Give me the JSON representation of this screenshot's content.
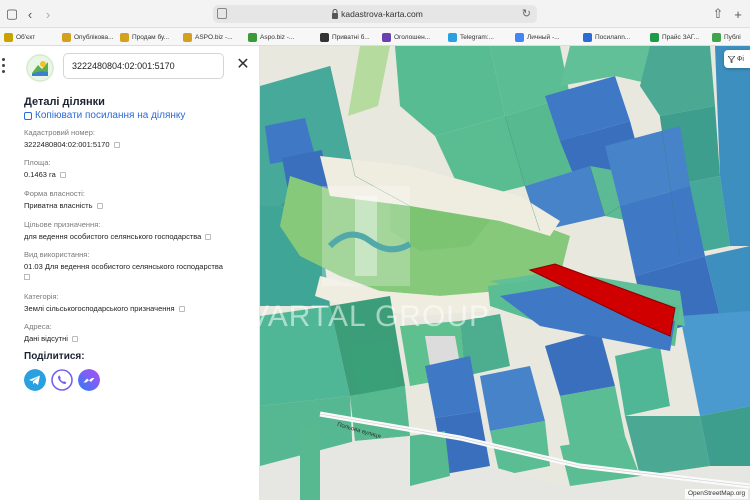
{
  "browser": {
    "url": "kadastrova-karta.com",
    "bookmarks": [
      {
        "label": "Об'єкт",
        "color": "#c8a200"
      },
      {
        "label": "Опублікова...",
        "color": "#d4a020"
      },
      {
        "label": "Продам бу...",
        "color": "#d4a020"
      },
      {
        "label": "ASPO.biz -...",
        "color": "#d4a020"
      },
      {
        "label": "Aspo.biz -...",
        "color": "#3a9a3a"
      },
      {
        "label": "Приватні б...",
        "color": "#333333"
      },
      {
        "label": "Оголошен...",
        "color": "#6b3fb0"
      },
      {
        "label": "Telegram:...",
        "color": "#2aa0e0"
      },
      {
        "label": "Личный -...",
        "color": "#4285f4"
      },
      {
        "label": "Посилann...",
        "color": "#2a6bd6"
      },
      {
        "label": "Прайс ЗАГ...",
        "color": "#1e9b48"
      },
      {
        "label": "Публі",
        "color": "#3fa54a"
      }
    ]
  },
  "panel": {
    "search_value": "3222480804:02:001:5170",
    "title": "Деталі ділянки",
    "copy_link": "Копіювати посилання на ділянку",
    "fields": [
      {
        "label": "Кадастровий номер:",
        "value": "3222480804:02:001:5170"
      },
      {
        "label": "Площа:",
        "value": "0.1463 га"
      },
      {
        "label": "Форма власності:",
        "value": "Приватна власність"
      },
      {
        "label": "Цільове призначення:",
        "value": "для ведення особистого селянського господарства"
      },
      {
        "label": "Вид використання:",
        "value": "01.03 Для ведення особистого селянського господарства"
      },
      {
        "label": "Категорія:",
        "value": "Землі сільськогосподарського призначення"
      },
      {
        "label": "Адреса:",
        "value": "Дані відсутні"
      }
    ],
    "share_title": "Поділитися:",
    "share": [
      {
        "icon": "telegram-icon",
        "color": "#2aa0e0"
      },
      {
        "icon": "viber-icon",
        "color": "#7360f2"
      },
      {
        "icon": "messenger-icon",
        "color": "#4a6cf7"
      }
    ]
  },
  "map": {
    "filter_label": "Фі",
    "street_label": "Польова вулиця",
    "watermark": "KVARTAL GROUP",
    "attribution": "OpenStreetMap.org",
    "colors": {
      "green_parcel": "#5bbd94",
      "teal_parcel": "#3fa596",
      "blue_parcel": "#3f78c4",
      "selected_parcel": "#d00000",
      "forest": "#86c97a"
    }
  }
}
